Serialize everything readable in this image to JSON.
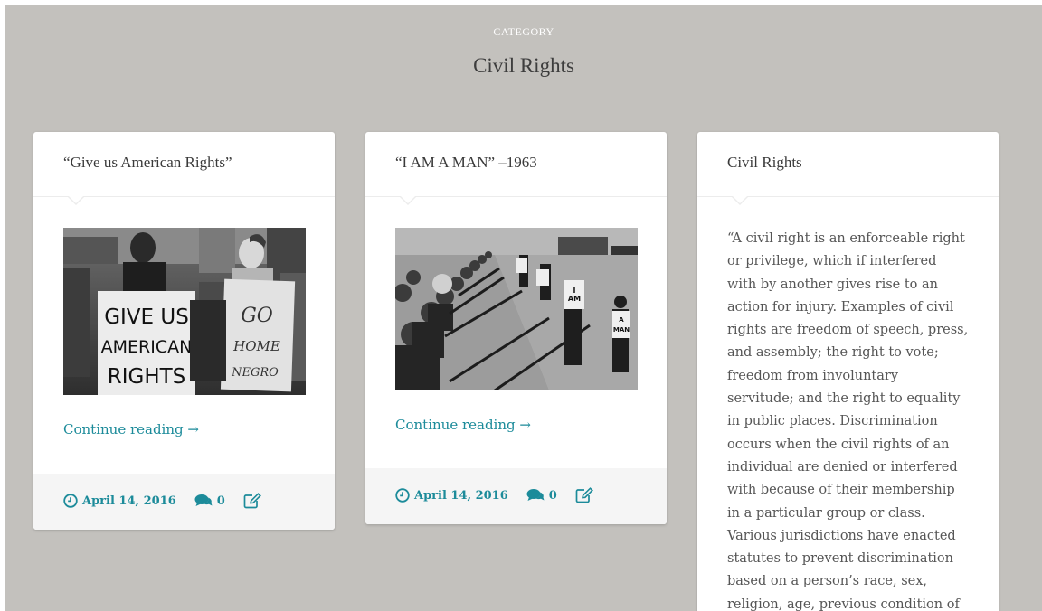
{
  "archive": {
    "label": "CATEGORY",
    "title": "Civil Rights"
  },
  "posts": [
    {
      "title": "“Give us American Rights”",
      "continue_label": "Continue reading →",
      "date": "April 14, 2016",
      "comments": "0",
      "image": {
        "sign_left": [
          "GIVE US",
          "AMERICAN",
          "RIGHTS"
        ],
        "sign_right": [
          "GO",
          "HOME",
          "NEGRO"
        ]
      }
    },
    {
      "title": "“I AM A MAN” –1963",
      "continue_label": "Continue reading →",
      "date": "April 14, 2016",
      "comments": "0",
      "image": {
        "sign_text": [
          "I",
          "AM",
          "A",
          "MAN"
        ]
      }
    },
    {
      "title": "Civil Rights",
      "excerpt_lines": [
        "“A civil right is an enforceable right",
        "or privilege, which if interfered",
        "with by another gives rise to an",
        "action for injury. Examples of civil",
        "rights are freedom of speech, press,",
        "and assembly; the right to vote;",
        "freedom from involuntary",
        "servitude; and the right to equality",
        "in public places. Discrimination",
        "occurs when the civil rights of an",
        "individual are denied or interfered",
        "with because of their membership",
        "in a particular group or class.",
        "Various jurisdictions have enacted",
        "statutes to prevent discrimination",
        "based on a person’s race, sex,",
        "religion, age, previous condition of"
      ]
    }
  ],
  "icons": {
    "date": "clock-icon",
    "comments": "comments-icon",
    "edit": "edit-icon"
  },
  "colors": {
    "background": "#c3c1bd",
    "accent": "#1c8b9a",
    "card": "#ffffff",
    "footer": "#f5f5f5"
  }
}
